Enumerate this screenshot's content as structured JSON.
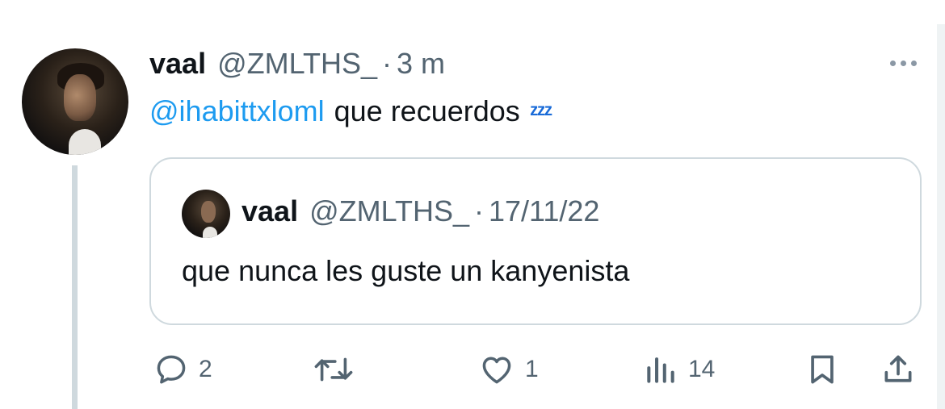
{
  "tweet": {
    "author_name": "vaal",
    "author_handle": "@ZMLTHS_",
    "separator": "·",
    "time": "3 m",
    "mention": "@ihabittxloml",
    "text": "que recuerdos",
    "emoji": "ᶻᶻᶻ"
  },
  "quote": {
    "author_name": "vaal",
    "author_handle": "@ZMLTHS_",
    "separator": "·",
    "date": "17/11/22",
    "text": "que nunca les guste un kanyenista"
  },
  "actions": {
    "reply_count": "2",
    "retweet_count": "",
    "like_count": "1",
    "views_count": "14"
  },
  "icons": {
    "more": "more-dots-icon",
    "reply": "reply-icon",
    "retweet": "retweet-icon",
    "like": "heart-icon",
    "views": "analytics-icon",
    "bookmark": "bookmark-icon",
    "share": "share-icon"
  },
  "colors": {
    "link": "#1d9bf0",
    "secondary": "#536471",
    "border": "#cfd9de"
  }
}
